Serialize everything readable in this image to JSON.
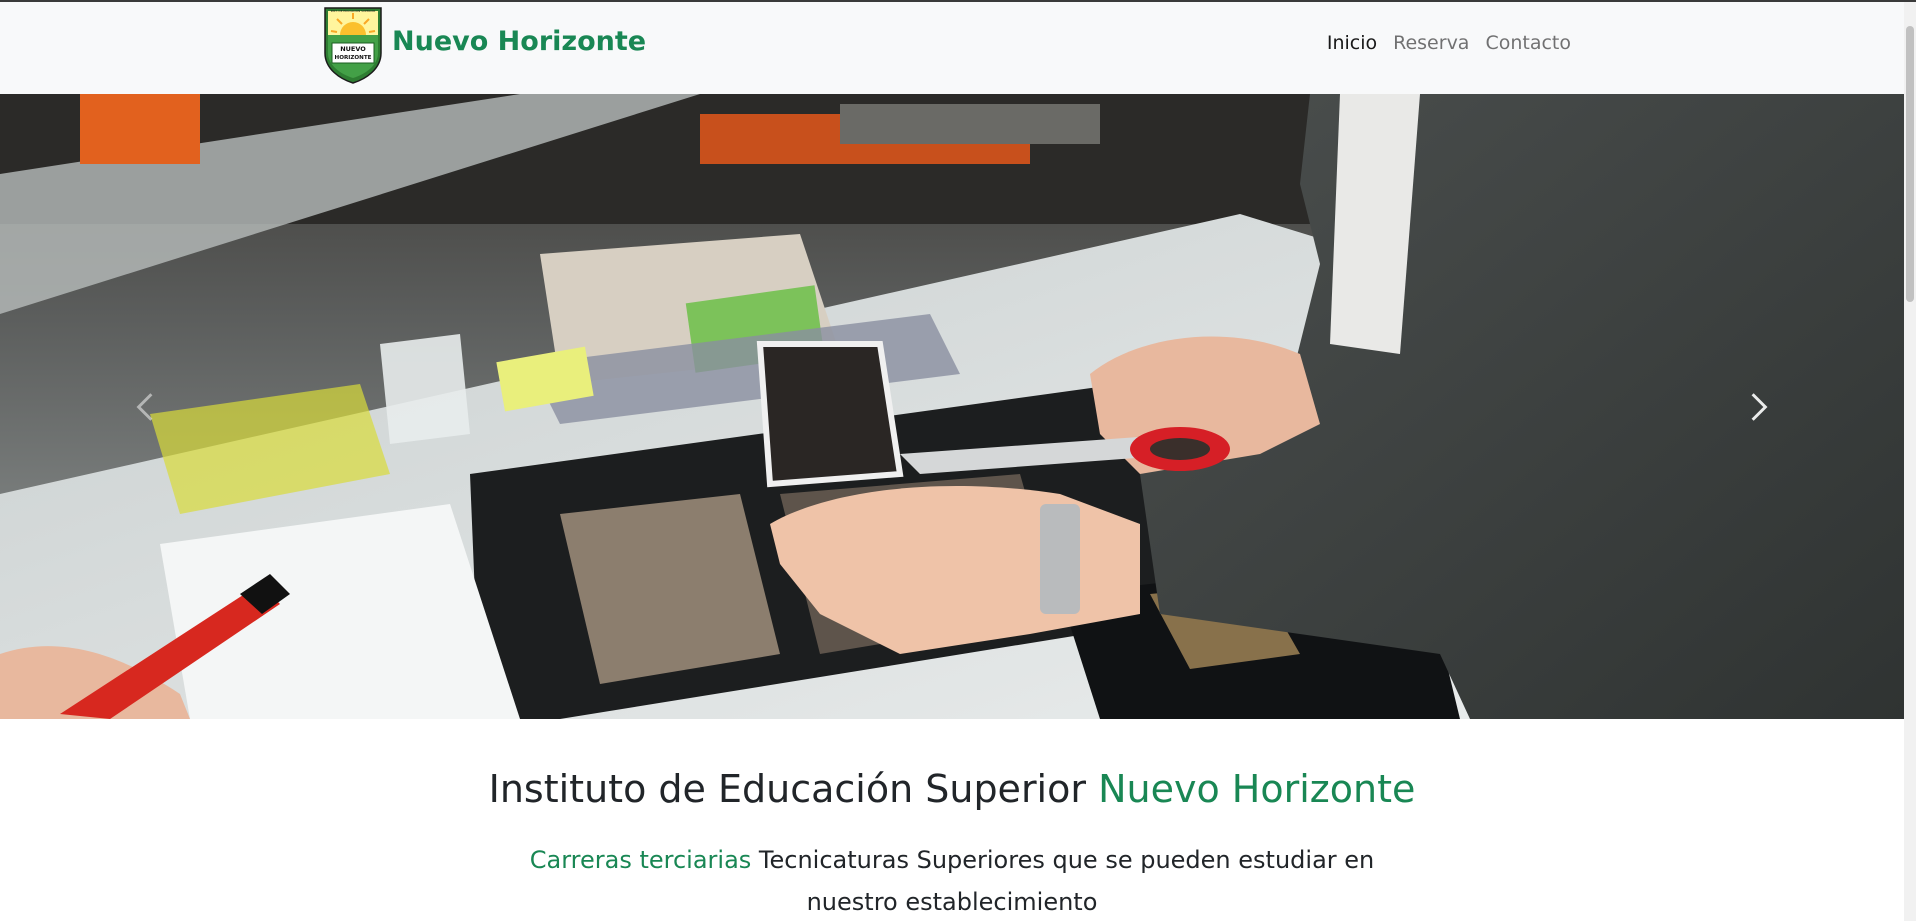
{
  "navbar": {
    "brand_name": "Nuevo Horizonte",
    "logo_text_top": "INST. DE EDUCACION SUPERIOR",
    "logo_text_main_1": "NUEVO",
    "logo_text_main_2": "HORIZONTE",
    "links": [
      {
        "label": "Inicio",
        "active": true
      },
      {
        "label": "Reserva",
        "active": false
      },
      {
        "label": "Contacto",
        "active": false
      }
    ]
  },
  "carousel": {
    "prev_icon": "chevron-left-icon",
    "next_icon": "chevron-right-icon"
  },
  "main": {
    "title_part1": "Instituto de Educación Superior ",
    "title_part2": "Nuevo Horizonte",
    "lead_part1": "Carreras terciarias",
    "lead_part2": " Tecnicaturas Superiores que se pueden estudiar en nuestro establecimiento"
  },
  "colors": {
    "brand_green": "#198754",
    "navbar_bg": "#f8f9fa",
    "text_dark": "#212529"
  }
}
